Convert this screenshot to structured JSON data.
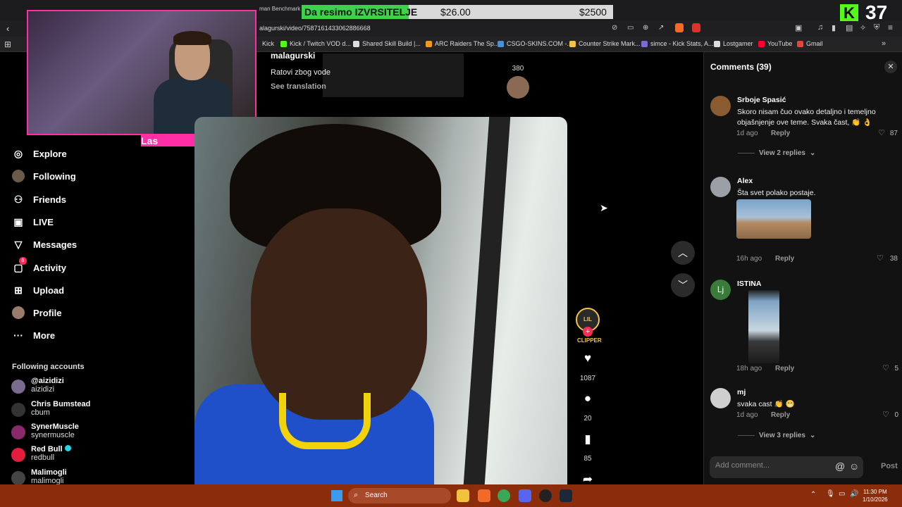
{
  "overlay": {
    "banner_text": "Da resimo IZVRSITELJE",
    "banner_amount1": "$26.00",
    "banner_amount2": "$2500",
    "bench_text": "man Benchmark",
    "kick_count": "37",
    "webcam_label": "Las"
  },
  "browser": {
    "url": "alagurski/video/7587161433062886668",
    "bookmarks": [
      {
        "label": "Kick"
      },
      {
        "label": "Kick / Twitch VOD d..."
      },
      {
        "label": "Shared Skill Build |..."
      },
      {
        "label": "ARC Raiders The Sp..."
      },
      {
        "label": "CSGO-SKINS.COM -..."
      },
      {
        "label": "Counter Strike Mark..."
      },
      {
        "label": "simce - Kick Stats, A..."
      },
      {
        "label": "Lostgamer"
      },
      {
        "label": "YouTube"
      },
      {
        "label": "Gmail"
      }
    ]
  },
  "sidebar": {
    "nav": [
      {
        "label": "Explore",
        "icon": "compass-icon"
      },
      {
        "label": "Following",
        "icon": "following-avatar-icon"
      },
      {
        "label": "Friends",
        "icon": "friends-icon"
      },
      {
        "label": "LIVE",
        "icon": "live-icon"
      },
      {
        "label": "Messages",
        "icon": "messages-icon"
      },
      {
        "label": "Activity",
        "icon": "activity-icon",
        "badge": "8"
      },
      {
        "label": "Upload",
        "icon": "upload-icon"
      },
      {
        "label": "Profile",
        "icon": "profile-avatar-icon"
      },
      {
        "label": "More",
        "icon": "more-icon"
      }
    ],
    "following_title": "Following accounts",
    "accounts": [
      {
        "name": "@aizidizi",
        "handle": "aizidizi"
      },
      {
        "name": "Chris Bumstead",
        "handle": "cbum"
      },
      {
        "name": "SynerMuscle",
        "handle": "synermuscle"
      },
      {
        "name": "Red Bull",
        "handle": "redbull"
      },
      {
        "name": "Malimogli",
        "handle": "malimogli"
      }
    ]
  },
  "prev_post": {
    "title": "malagurski",
    "desc": "Ratovi zbog vode",
    "translate": "See translation",
    "count": "380"
  },
  "video": {
    "creator_badge": "LIL CLIPPER",
    "likes": "1087",
    "comments": "20",
    "saves": "85"
  },
  "comments": {
    "header": "Comments (39)",
    "placeholder": "Add comment...",
    "post_label": "Post",
    "items": [
      {
        "name": "Srboje Spasić",
        "text": "Skoro nisam čuo ovako detaljno i temeljno objašnjenje ove teme. Svaka čast, 👏 👌",
        "time": "1d ago",
        "reply": "Reply",
        "likes": "87",
        "view_replies": "View 2 replies"
      },
      {
        "name": "Alex",
        "text": "Šta svet polako postaje.",
        "time": "16h ago",
        "reply": "Reply",
        "likes": "38"
      },
      {
        "name": "ISTINA",
        "text": "",
        "time": "18h ago",
        "reply": "Reply",
        "likes": "5",
        "avatar_letter": "Lj"
      },
      {
        "name": "mj",
        "text": "svaka cast 👏 😁",
        "time": "1d ago",
        "reply": "Reply",
        "likes": "0",
        "view_replies": "View 3 replies"
      }
    ]
  },
  "taskbar": {
    "search": "Search",
    "time": "11:30 PM",
    "date": "1/10/2026"
  }
}
